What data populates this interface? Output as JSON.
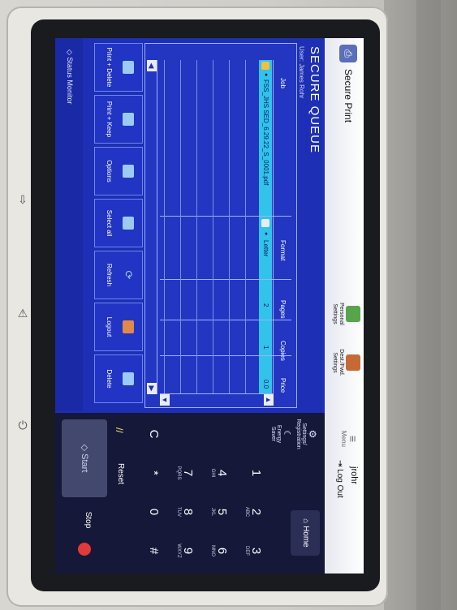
{
  "device": {
    "hardware_buttons": [
      "login-icon",
      "warning-icon",
      "power-icon"
    ]
  },
  "topbar": {
    "app_title": "Secure Print",
    "personal_settings": "Personal Settings",
    "dest_settings": "Dest./Fwd. Settings",
    "menu": "Menu",
    "user": "jrohr",
    "logout": "Log Out"
  },
  "screen": {
    "heading": "SECURE QUEUE",
    "subheading": "User: James Rohr"
  },
  "table": {
    "columns": [
      "Job",
      "Format",
      "Pages",
      "Copies",
      "Price"
    ],
    "rows": [
      {
        "job": "FSS_JHS SED_6.29.22_S_0001.pdf",
        "format": "Letter",
        "pages": "2",
        "copies": "1",
        "price": "0.0"
      }
    ]
  },
  "actions": [
    "Print + Delete",
    "Print + Keep",
    "Options",
    "Select all",
    "Refresh",
    "Logout",
    "Delete"
  ],
  "footer": {
    "status_monitor": "Status Monitor"
  },
  "keypad": {
    "settings": "Settings/ Registration",
    "energy": "Energy Saver",
    "home": "Home",
    "keys": [
      {
        "d": "1",
        "l": ""
      },
      {
        "d": "2",
        "l": "ABC"
      },
      {
        "d": "3",
        "l": "DEF"
      },
      {
        "d": "4",
        "l": "GHI"
      },
      {
        "d": "5",
        "l": "JKL"
      },
      {
        "d": "6",
        "l": "MNO"
      },
      {
        "d": "7",
        "l": "PQRS"
      },
      {
        "d": "8",
        "l": "TUV"
      },
      {
        "d": "9",
        "l": "WXYZ"
      },
      {
        "d": "*",
        "l": ""
      },
      {
        "d": "0",
        "l": ""
      },
      {
        "d": "#",
        "l": ""
      }
    ],
    "clear": "C",
    "reset": "Reset",
    "start": "Start",
    "stop": "Stop"
  },
  "colors": {
    "screen_bg": "#1d2fb4",
    "selected_row": "#31c3ea",
    "stop": "#e23a3a"
  }
}
